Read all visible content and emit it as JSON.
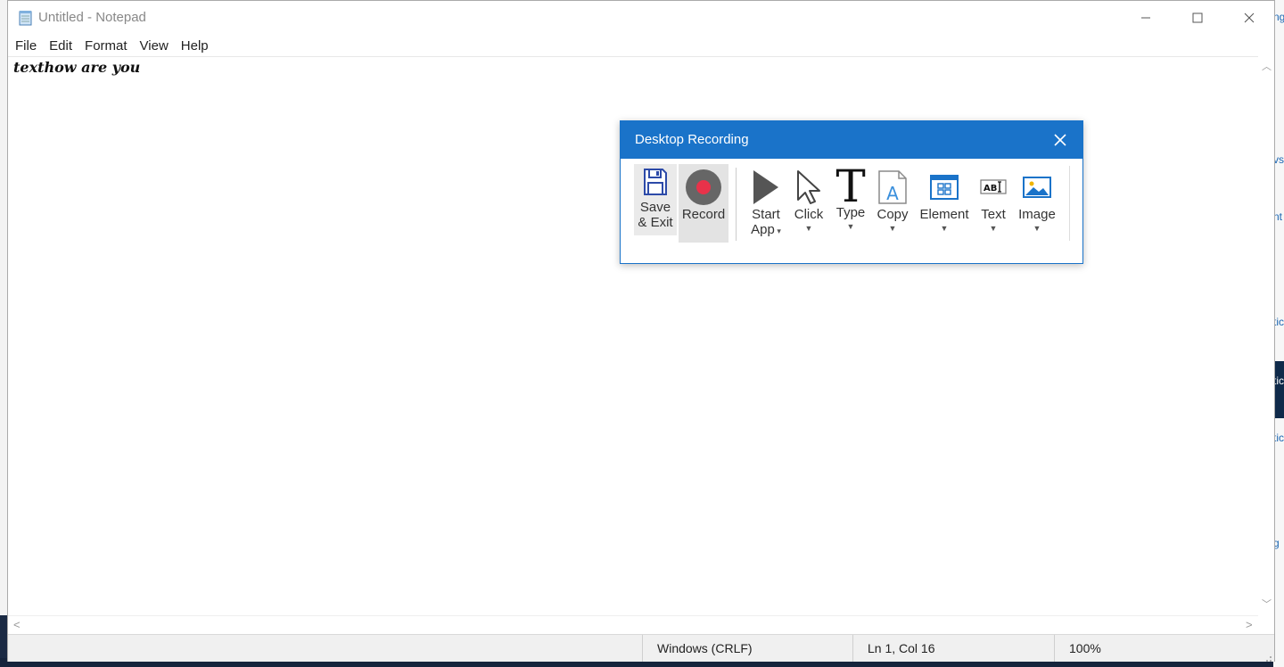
{
  "notepad": {
    "title": "Untitled - Notepad",
    "menu": [
      "File",
      "Edit",
      "Format",
      "View",
      "Help"
    ],
    "content": "texthow are you",
    "status": {
      "line_ending": "Windows (CRLF)",
      "position": "Ln 1, Col 16",
      "zoom": "100%"
    }
  },
  "recorder": {
    "title": "Desktop Recording",
    "tools": [
      {
        "line1": "Save",
        "line2": "& Exit",
        "icon": "floppy-disk-icon"
      },
      {
        "line1": "Record",
        "line2": "",
        "icon": "record-icon"
      },
      {
        "line1": "Start",
        "line2": "App",
        "icon": "play-icon"
      },
      {
        "line1": "Click",
        "line2": "",
        "icon": "cursor-icon"
      },
      {
        "line1": "Type",
        "line2": "",
        "icon": "type-icon"
      },
      {
        "line1": "Copy",
        "line2": "",
        "icon": "copy-icon"
      },
      {
        "line1": "Element",
        "line2": "",
        "icon": "element-icon"
      },
      {
        "line1": "Text",
        "line2": "",
        "icon": "text-field-icon"
      },
      {
        "line1": "Image",
        "line2": "",
        "icon": "image-icon"
      }
    ]
  },
  "background_fragments": [
    "ng",
    "vs",
    "nt",
    "tic",
    "tic",
    "tic",
    "g"
  ],
  "colors": {
    "dialog_accent": "#1a73c9",
    "record_dot": "#e8324a"
  }
}
